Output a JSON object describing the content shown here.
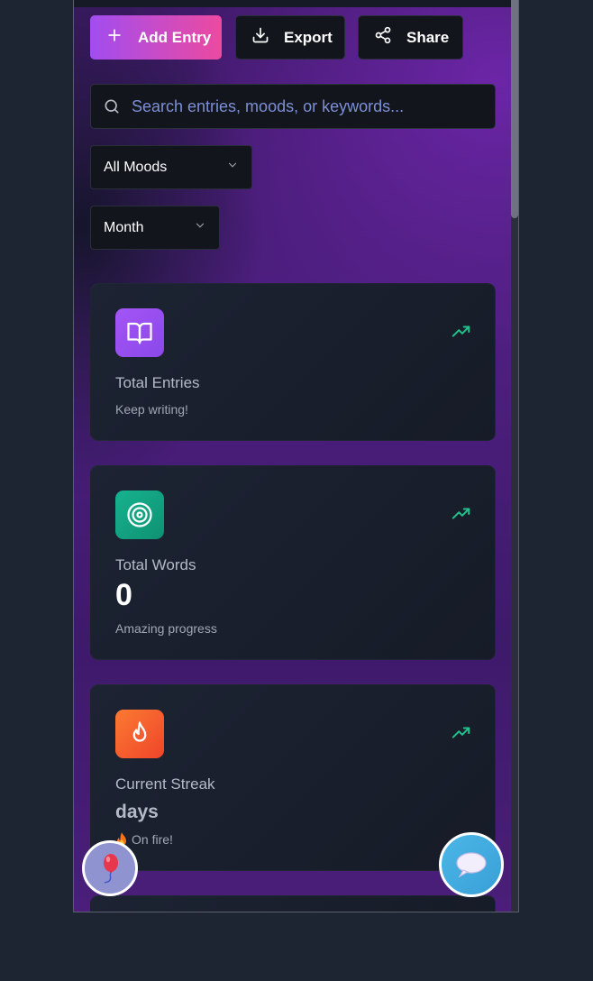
{
  "toolbar": {
    "add_label": "Add Entry",
    "export_label": "Export",
    "share_label": "Share"
  },
  "search": {
    "placeholder": "Search entries, moods, or keywords..."
  },
  "filters": {
    "mood": "All Moods",
    "period": "Month"
  },
  "stats": {
    "total_entries": {
      "label": "Total Entries",
      "value": "",
      "sub": "Keep writing!",
      "icon": "book-open-icon"
    },
    "total_words": {
      "label": "Total Words",
      "value": "0",
      "sub": "Amazing progress",
      "icon": "target-icon"
    },
    "current_streak": {
      "label": "Current Streak",
      "value": " days",
      "sub": "On fire!",
      "icon": "flame-icon"
    }
  },
  "colors": {
    "accent_start": "#a24df0",
    "accent_end": "#ec4aa0",
    "trend": "#22c08a",
    "placeholder": "#7d8fd6"
  }
}
